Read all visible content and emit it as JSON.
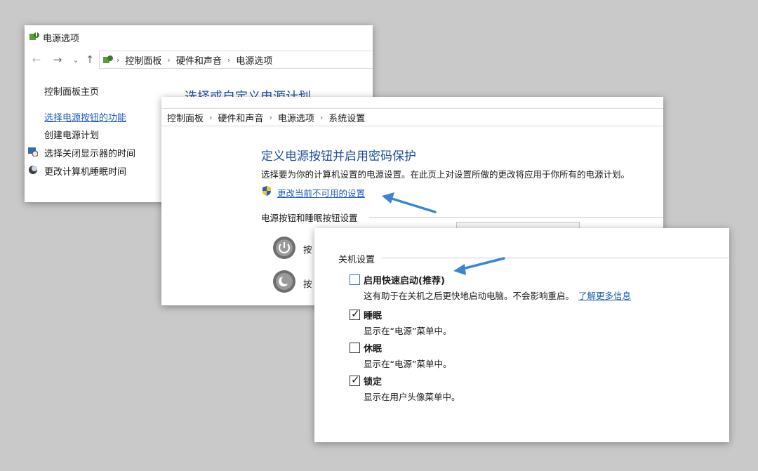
{
  "colors": {
    "background": "#c9c9c9",
    "link": "#1e5bb8",
    "heading": "#1e4fa0",
    "arrow": "#3a86d4"
  },
  "window1": {
    "title": "电源选项",
    "breadcrumb": [
      "控制面板",
      "硬件和声音",
      "电源选项"
    ],
    "sidebar": {
      "home": "控制面板主页",
      "power_button": "选择电源按钮的功能",
      "create_plan": "创建电源计划",
      "display_off": "选择关闭显示器的时间",
      "sleep_time": "更改计算机睡眠时间"
    },
    "heading_partial": "选择或自定义电源计划"
  },
  "window2": {
    "breadcrumb": [
      "控制面板",
      "硬件和声音",
      "电源选项",
      "系统设置"
    ],
    "heading": "定义电源按钮并启用密码保护",
    "description": "选择要为你的计算机设置的电源设置。在此页上对设置所做的更改将应用于你所有的电源计划。",
    "change_link": "更改当前不可用的设置",
    "section_title": "电源按钮和睡眠按钮设置",
    "row1_partial": "按",
    "row2_partial": "按"
  },
  "window3": {
    "group_title": "关机设置",
    "options": [
      {
        "label": "启用快速启动(推荐)",
        "desc": "这有助于在关机之后更快地启动电脑。不会影响重启。",
        "link": "了解更多信息",
        "checked": false
      },
      {
        "label": "睡眠",
        "desc": "显示在“电源”菜单中。",
        "checked": true
      },
      {
        "label": "休眠",
        "desc": "显示在“电源”菜单中。",
        "checked": false
      },
      {
        "label": "锁定",
        "desc": "显示在用户头像菜单中。",
        "checked": true
      }
    ]
  }
}
